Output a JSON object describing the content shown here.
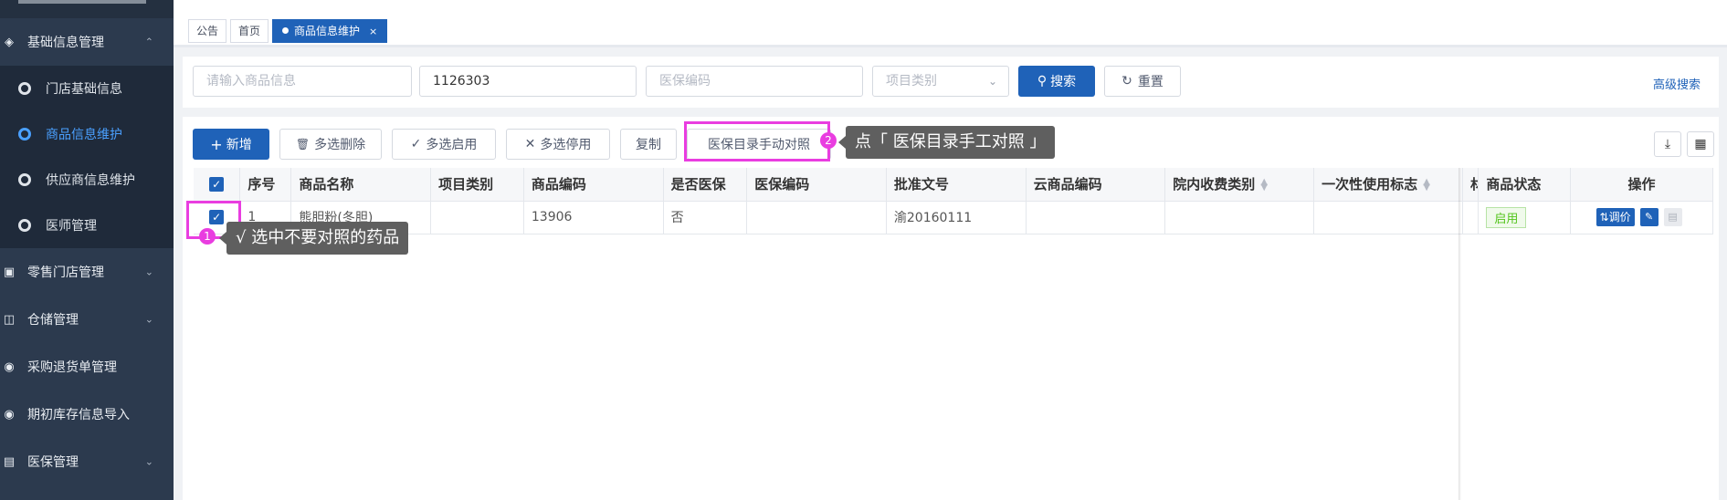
{
  "sidebar": {
    "groups": [
      {
        "label": "基础信息管理",
        "chevron": "up"
      },
      {
        "label": "零售门店管理",
        "chevron": "down"
      },
      {
        "label": "仓储管理",
        "chevron": "down"
      },
      {
        "label": "采购退货单管理"
      },
      {
        "label": "期初库存信息导入"
      },
      {
        "label": "医保管理",
        "chevron": "down"
      }
    ],
    "items": [
      {
        "label": "门店基础信息"
      },
      {
        "label": "商品信息维护",
        "active": true
      },
      {
        "label": "供应商信息维护"
      },
      {
        "label": "医师管理"
      }
    ]
  },
  "tabs": [
    {
      "label": "公告"
    },
    {
      "label": "首页"
    },
    {
      "label": "商品信息维护",
      "close": "×",
      "active": true
    }
  ],
  "search": {
    "product_placeholder": "请输入商品信息",
    "code_value": "1126303",
    "insurance_code_placeholder": "医保编码",
    "category_placeholder": "项目类别",
    "search_label": "搜索",
    "reset_label": "重置",
    "advanced_label": "高级搜索"
  },
  "toolbar": {
    "add_label": "新增",
    "batch_delete_label": "多选删除",
    "batch_enable_label": "多选启用",
    "batch_disable_label": "多选停用",
    "copy_label": "复制",
    "manual_match_label": "医保目录手动对照"
  },
  "table": {
    "headers": [
      "序号",
      "商品名称",
      "项目类别",
      "商品编码",
      "是否医保",
      "医保编码",
      "批准文号",
      "云商品编码",
      "院内收费类别",
      "一次性使用标志",
      "材",
      "商品状态",
      "操作"
    ],
    "rows": [
      {
        "index": "1",
        "name": "熊胆粉(冬胆)",
        "category": "",
        "code": "13906",
        "is_insurance": "否",
        "insurance_code": "",
        "approval_no": "渝20160111",
        "cloud_code": "",
        "fee_category": "",
        "disposable_flag": "",
        "status": "启用",
        "op_adjust_price": "调价"
      }
    ]
  },
  "annotations": {
    "step1_number": "1",
    "step1_text": "√  选中不要对照的药品",
    "step2_number": "2",
    "step2_text": "点「 医保目录手工对照 」"
  },
  "colors": {
    "primary": "#1f62b8",
    "sidebar_bg": "#2c3a4e",
    "highlight": "#e93de0",
    "status_green": "#52c41a"
  }
}
